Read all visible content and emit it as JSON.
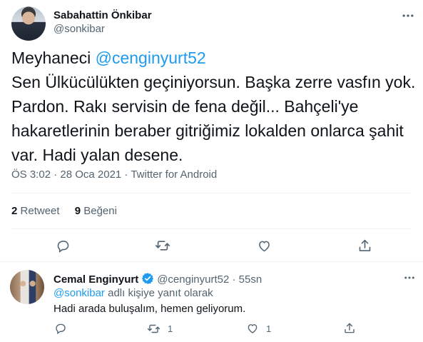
{
  "tweet": {
    "author_name": "Sabahattin Önkibar",
    "author_handle": "@sonkibar",
    "lines": [
      {
        "prefix": "Meyhaneci ",
        "mention": "@cenginyurt52"
      },
      {
        "text": "Sen Ülkücülükten geçiniyorsun. Başka zerre vasfın yok."
      },
      {
        "text": "Pardon. Rakı servisin de fena değil... Bahçeli'ye"
      },
      {
        "text": "hakaretlerinin beraber gitriğimiz lokalden onlarca şahit"
      },
      {
        "text": "var. Hadi yalan desene."
      }
    ],
    "timestamp": "ÖS 3:02 · 28 Oca 2021",
    "separator": " · ",
    "source": "Twitter for Android",
    "retweets_count": "2",
    "retweets_label": "Retweet",
    "likes_count": "9",
    "likes_label": "Beğeni"
  },
  "icons": {
    "more": "more-horizontal-icon",
    "reply": "reply-icon",
    "retweet": "retweet-icon",
    "like": "heart-icon",
    "share": "share-icon",
    "verified": "verified-badge-icon"
  },
  "reply": {
    "author_name": "Cemal Enginyurt",
    "author_handle": "@cenginyurt52",
    "separator": " · ",
    "time": "55sn",
    "replying_mention": "@sonkibar",
    "replying_suffix": " adlı kişiye yanıt olarak",
    "text": "Hadi arada buluşalım, hemen geliyorum.",
    "retweet_count": "1",
    "like_count": "1"
  },
  "colors": {
    "accent": "#1d9bf0",
    "text": "#0f1419",
    "muted": "#536471",
    "divider": "#eff3f4"
  }
}
